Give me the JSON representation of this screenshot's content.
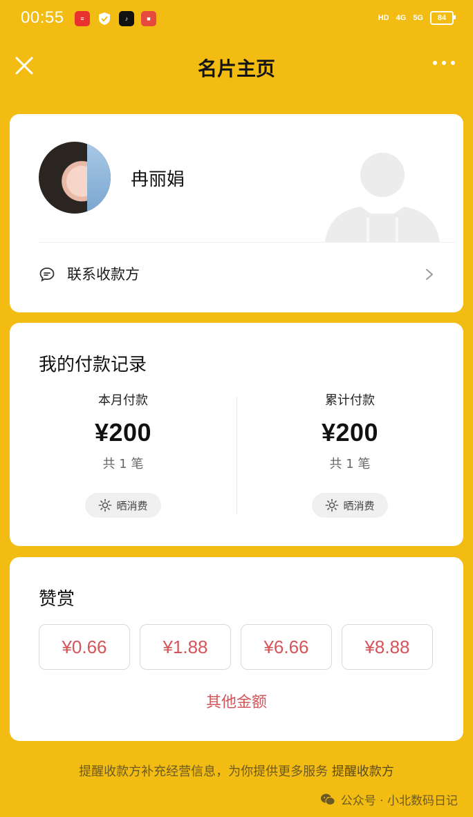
{
  "status_bar": {
    "time": "00:55",
    "battery": "84",
    "network": [
      "HD",
      "4G",
      "5G"
    ]
  },
  "header": {
    "title": "名片主页"
  },
  "profile": {
    "name": "冉丽娟",
    "contact_label": "联系收款方"
  },
  "payment_record": {
    "title": "我的付款记录",
    "month": {
      "label": "本月付款",
      "amount": "¥200",
      "count": "共 1 笔",
      "share": "晒消费"
    },
    "total": {
      "label": "累计付款",
      "amount": "¥200",
      "count": "共 1 笔",
      "share": "晒消费"
    }
  },
  "reward": {
    "title": "赞赏",
    "amounts": [
      "¥0.66",
      "¥1.88",
      "¥6.66",
      "¥8.88"
    ],
    "other": "其他金额"
  },
  "footer": {
    "text": "提醒收款方补充经营信息，为你提供更多服务",
    "link": "提醒收款方"
  },
  "watermark": "公众号 · 小北数码日记",
  "colors": {
    "background": "#F2BC12",
    "accent_red": "#d3555a",
    "card": "#ffffff"
  },
  "icons": [
    "close-icon",
    "more-icon",
    "chat-icon",
    "chevron-right-icon",
    "sun-icon",
    "wechat-icon"
  ]
}
